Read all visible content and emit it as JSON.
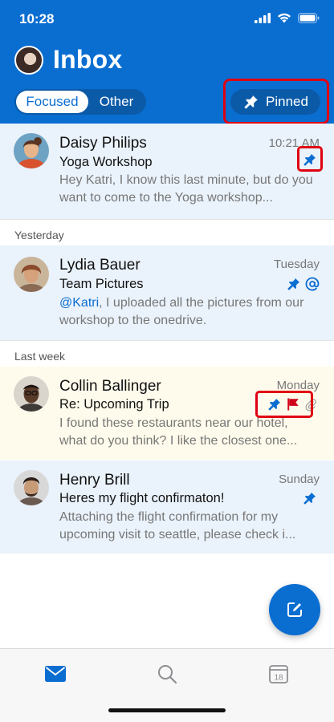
{
  "status_bar": {
    "time": "10:28"
  },
  "header": {
    "title": "Inbox",
    "tabs": [
      "Focused",
      "Other"
    ],
    "pinned_label": "Pinned",
    "accent": "#0a6ed1"
  },
  "emails": [
    {
      "sender": "Daisy Philips",
      "date": "10:21 AM",
      "subject": "Yoga Workshop",
      "preview": "Hey Katri, I know this last minute, but do you want to come to the Yoga workshop...",
      "icons": [
        "pin-icon"
      ]
    },
    {
      "sender": "Lydia Bauer",
      "date": "Tuesday",
      "subject": "Team Pictures",
      "mention": "@Katri",
      "preview": ", I uploaded all the pictures from our workshop to the onedrive.",
      "icons": [
        "pin-icon",
        "mention-icon"
      ]
    },
    {
      "sender": "Collin Ballinger",
      "date": "Monday",
      "subject": "Re: Upcoming Trip",
      "preview": "I found these restaurants near our hotel, what do you think? I like the closest one...",
      "icons": [
        "pin-icon",
        "flag-icon",
        "attachment-icon"
      ]
    },
    {
      "sender": "Henry Brill",
      "date": "Sunday",
      "subject": "Heres my flight confirmaton!",
      "preview": "Attaching the flight confirmation for my upcoming visit to seattle, please check i...",
      "icons": [
        "pin-icon"
      ]
    }
  ],
  "sections": {
    "yesterday": "Yesterday",
    "last_week": "Last week"
  },
  "tabbar": {
    "items": [
      "mail-icon",
      "search-icon",
      "calendar-icon"
    ],
    "calendar_day": "18"
  }
}
